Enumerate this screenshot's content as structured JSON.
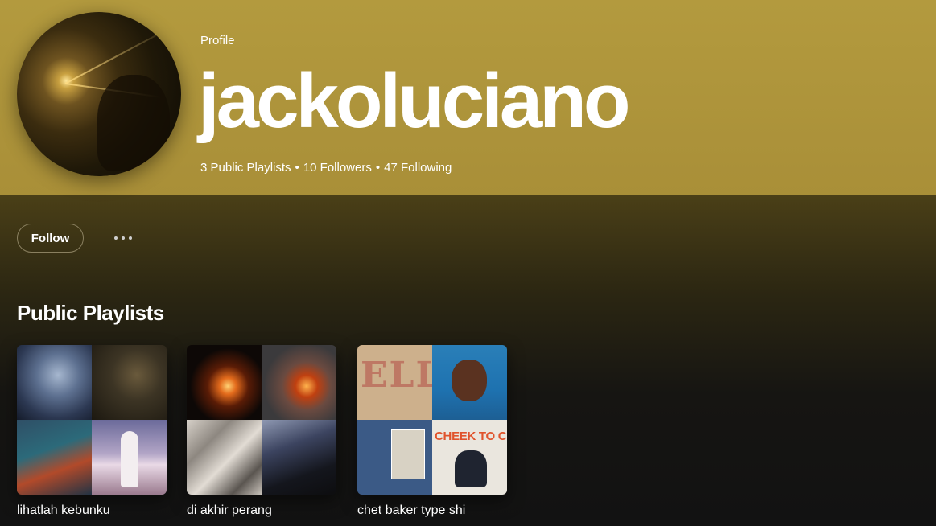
{
  "profile": {
    "type_label": "Profile",
    "username": "jackoluciano",
    "stats": {
      "playlists": "3 Public Playlists",
      "followers": "10 Followers",
      "following": "47 Following",
      "separator": "•"
    },
    "accent_color": "#b39a3e"
  },
  "actions": {
    "follow_label": "Follow",
    "more_icon": "more-horizontal-icon"
  },
  "section": {
    "title": "Public Playlists"
  },
  "playlists": [
    {
      "title": "lihatlah kebunku",
      "cover_text": ""
    },
    {
      "title": "di akhir perang",
      "cover_text": ""
    },
    {
      "title": "chet baker type shi",
      "cover_text": [
        "ELLA",
        "CHEEK TO CHEEK"
      ]
    }
  ]
}
